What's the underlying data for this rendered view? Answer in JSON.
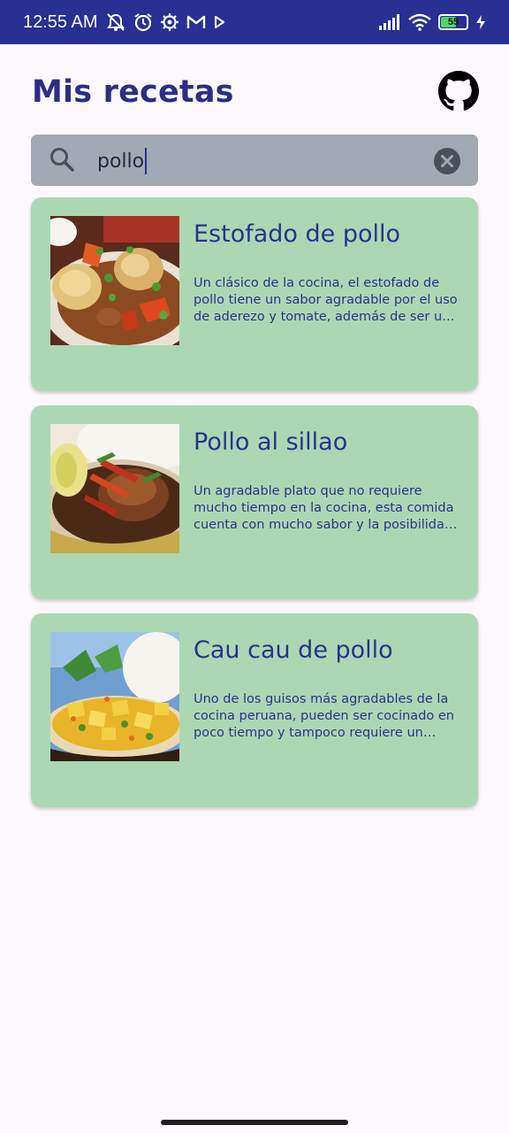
{
  "status_bar": {
    "time": "12:55 AM",
    "battery": "55",
    "icons_left": [
      "muted-alarm-icon",
      "alarm-clock-icon",
      "settings-icon",
      "gmail-icon",
      "play-icon"
    ],
    "icons_right": [
      "signal-icon",
      "wifi-icon",
      "battery-icon",
      "charging-icon"
    ]
  },
  "header": {
    "title": "Mis recetas",
    "action_icon": "github-icon"
  },
  "search": {
    "value": "pollo",
    "icon": "search-icon",
    "clear_icon": "clear-icon"
  },
  "recipes": [
    {
      "title": "Estofado de pollo",
      "description": "Un clásico de la cocina, el estofado de pollo tiene un sabor agradable por el uso de aderezo y tomate, además de ser un pl…"
    },
    {
      "title": "Pollo al sillao",
      "description": "Un agradable plato que no requiere mucho tiempo en la cocina, esta comida cuenta con mucho sabor y la posibilidad de delei…"
    },
    {
      "title": "Cau cau de pollo",
      "description": "Uno de los guisos más agradables de la cocina peruana, pueden ser cocinado en poco tiempo y tampoco requiere un gast…"
    }
  ],
  "colors": {
    "status_bar": "#283093",
    "title": "#2a2f86",
    "search_bg": "#a3a9b4",
    "card_bg": "#abd8b2",
    "card_text": "#2a3190",
    "background": "#fdf8fd"
  }
}
